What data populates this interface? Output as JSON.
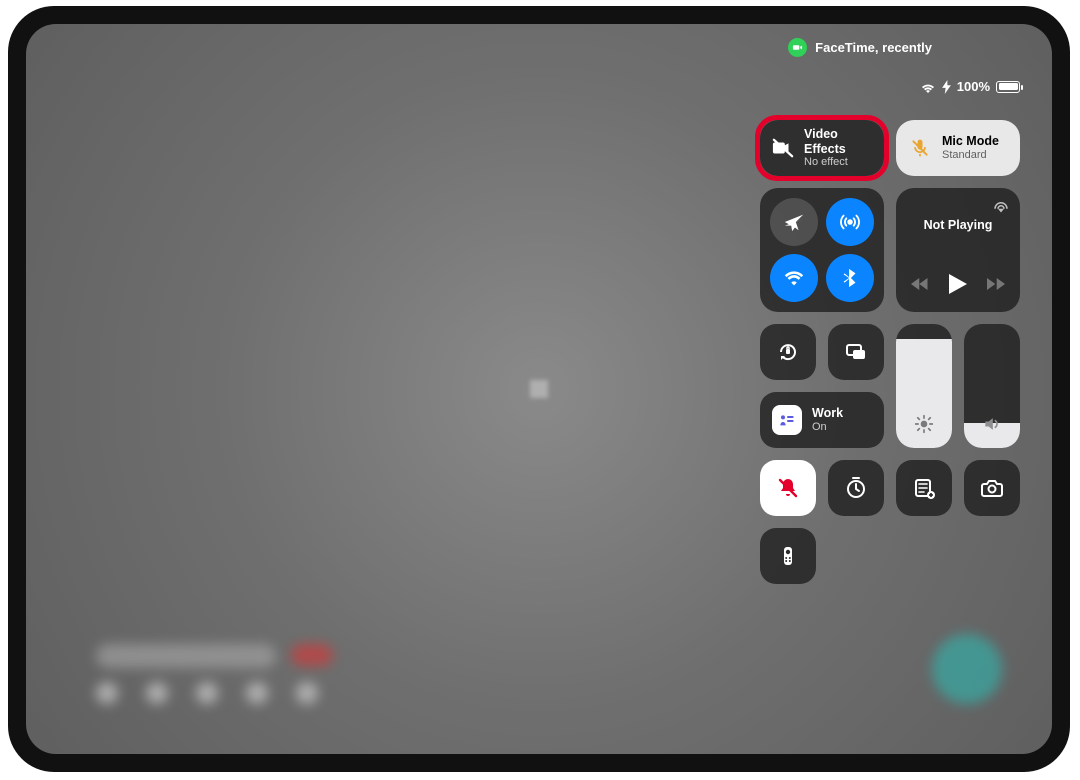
{
  "status_pill": {
    "label": "FaceTime, recently"
  },
  "status_bar": {
    "battery_pct": "100%"
  },
  "video_effects": {
    "title": "Video Effects",
    "subtitle": "No effect"
  },
  "mic_mode": {
    "title": "Mic Mode",
    "subtitle": "Standard"
  },
  "media": {
    "now_playing": "Not Playing"
  },
  "focus": {
    "title": "Work",
    "subtitle": "On"
  },
  "brightness": {
    "pct": 88
  },
  "volume": {
    "pct": 20
  }
}
